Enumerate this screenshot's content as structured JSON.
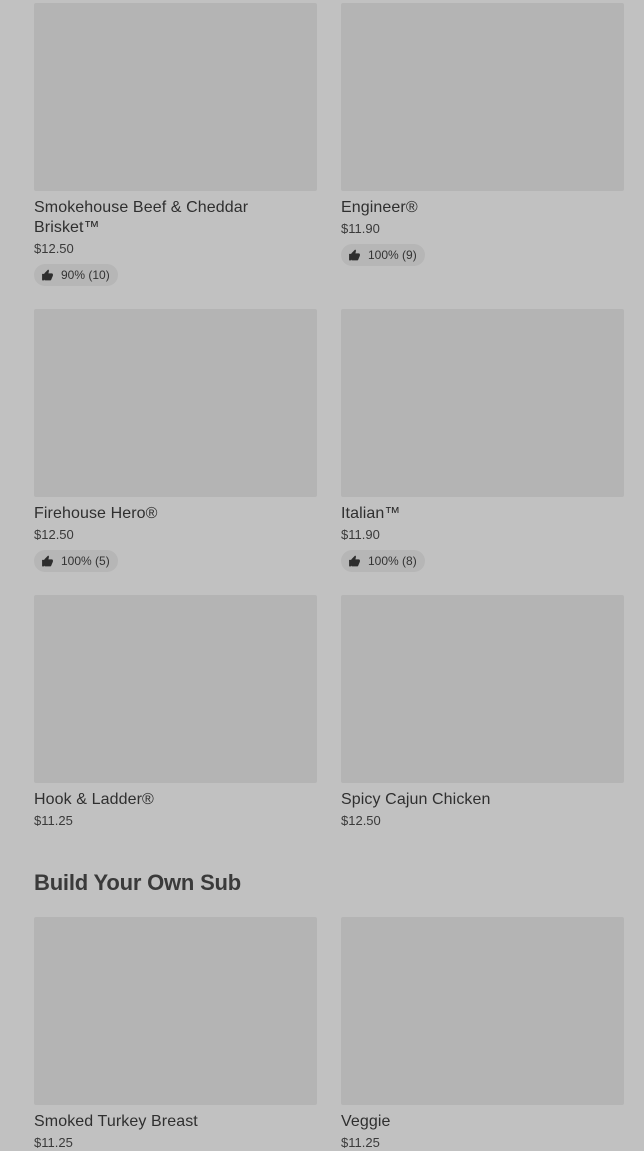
{
  "items_top": [
    {
      "name": "Smokehouse Beef & Cheddar Brisket™",
      "price": "$12.50",
      "rating": "90% (10)"
    },
    {
      "name": "Engineer®",
      "price": "$11.90",
      "rating": "100% (9)"
    },
    {
      "name": "Firehouse Hero®",
      "price": "$12.50",
      "rating": "100% (5)"
    },
    {
      "name": "Italian™",
      "price": "$11.90",
      "rating": "100% (8)"
    },
    {
      "name": "Hook & Ladder®",
      "price": "$11.25"
    },
    {
      "name": "Spicy Cajun Chicken",
      "price": "$12.50"
    }
  ],
  "section": {
    "title": "Build Your Own Sub"
  },
  "items_byo": [
    {
      "name": "Smoked Turkey Breast",
      "price": "$11.25"
    },
    {
      "name": "Veggie",
      "price": "$11.25"
    }
  ],
  "icons": {
    "rating": "thumbs-up-icon"
  }
}
